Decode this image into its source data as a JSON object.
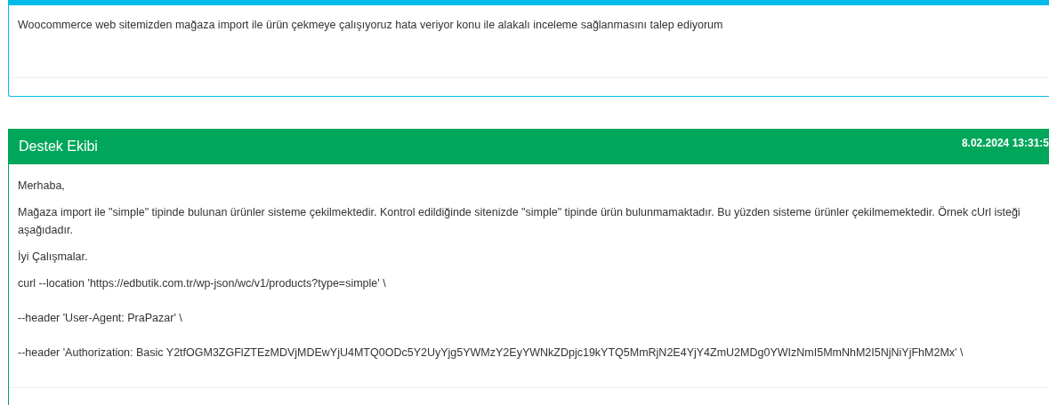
{
  "messages": [
    {
      "kind": "customer",
      "body": [
        "Woocommerce web sitemizden mağaza import ile ürün çekmeye çalışıyoruz hata veriyor konu ile alakalı inceleme sağlanmasını talep ediyorum"
      ]
    },
    {
      "kind": "support",
      "author": "Destek Ekibi",
      "date": "8.02.2024 13:31:5",
      "body": [
        "Merhaba,",
        "Mağaza import ile \"simple\" tipinde bulunan ürünler sisteme çekilmektedir. Kontrol edildiğinde sitenizde \"simple\" tipinde ürün bulunmamaktadır. Bu yüzden sisteme ürünler çekilmemektedir. Örnek cUrl isteği aşağıdadır.",
        "İyi Çalışmalar.",
        "curl --location 'https://edbutik.com.tr/wp-json/wc/v1/products?type=simple' \\",
        "--header 'User-Agent: PraPazar' \\",
        "--header 'Authorization: Basic Y2tfOGM3ZGFlZTEzMDVjMDEwYjU4MTQ0ODc5Y2UyYjg5YWMzY2EyYWNkZDpjc19kYTQ5MmRjN2E4YjY4ZmU2MDg0YWIzNmI5MmNhM2I5NjNiYjFhM2Mx' \\"
      ]
    }
  ]
}
